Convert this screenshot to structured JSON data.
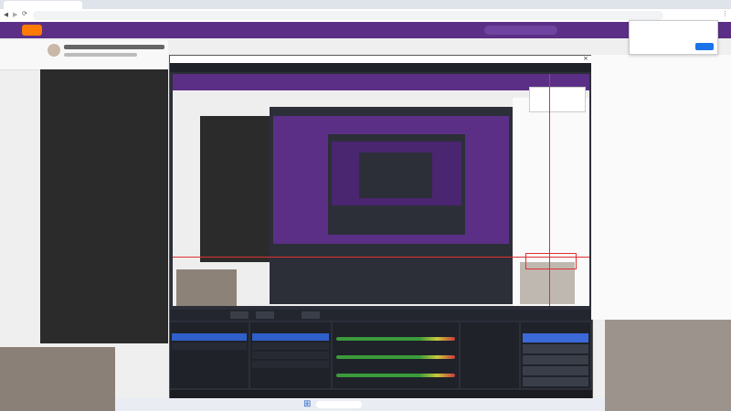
{
  "colors": {
    "browser_chrome": "#ffffff",
    "site_header": "#5b2f86",
    "stream_panel": "#2b2b2b",
    "obs_window": "#2c2f38",
    "obs_panel": "#1f2229",
    "obs_accent": "#3b6ad8",
    "selection": "#2f60c9",
    "chat_bg": "#fafafa",
    "taskbar": "#e9edf3",
    "marker_red": "#e03030"
  },
  "icons": {
    "back": "back-arrow-icon",
    "forward": "forward-arrow-icon",
    "reload": "reload-icon",
    "site_logo": "site-logo-icon",
    "browser_menu": "ellipsis-icon",
    "obs_close": "close-icon",
    "start": "windows-start-icon"
  },
  "obs": {
    "preview_nesting_levels": 5,
    "docks": [
      "scenes",
      "sources",
      "audio-mixer",
      "transitions",
      "controls"
    ],
    "scene_rows": 2,
    "source_rows": 4,
    "mixer_channels": 3,
    "control_buttons": 5
  }
}
